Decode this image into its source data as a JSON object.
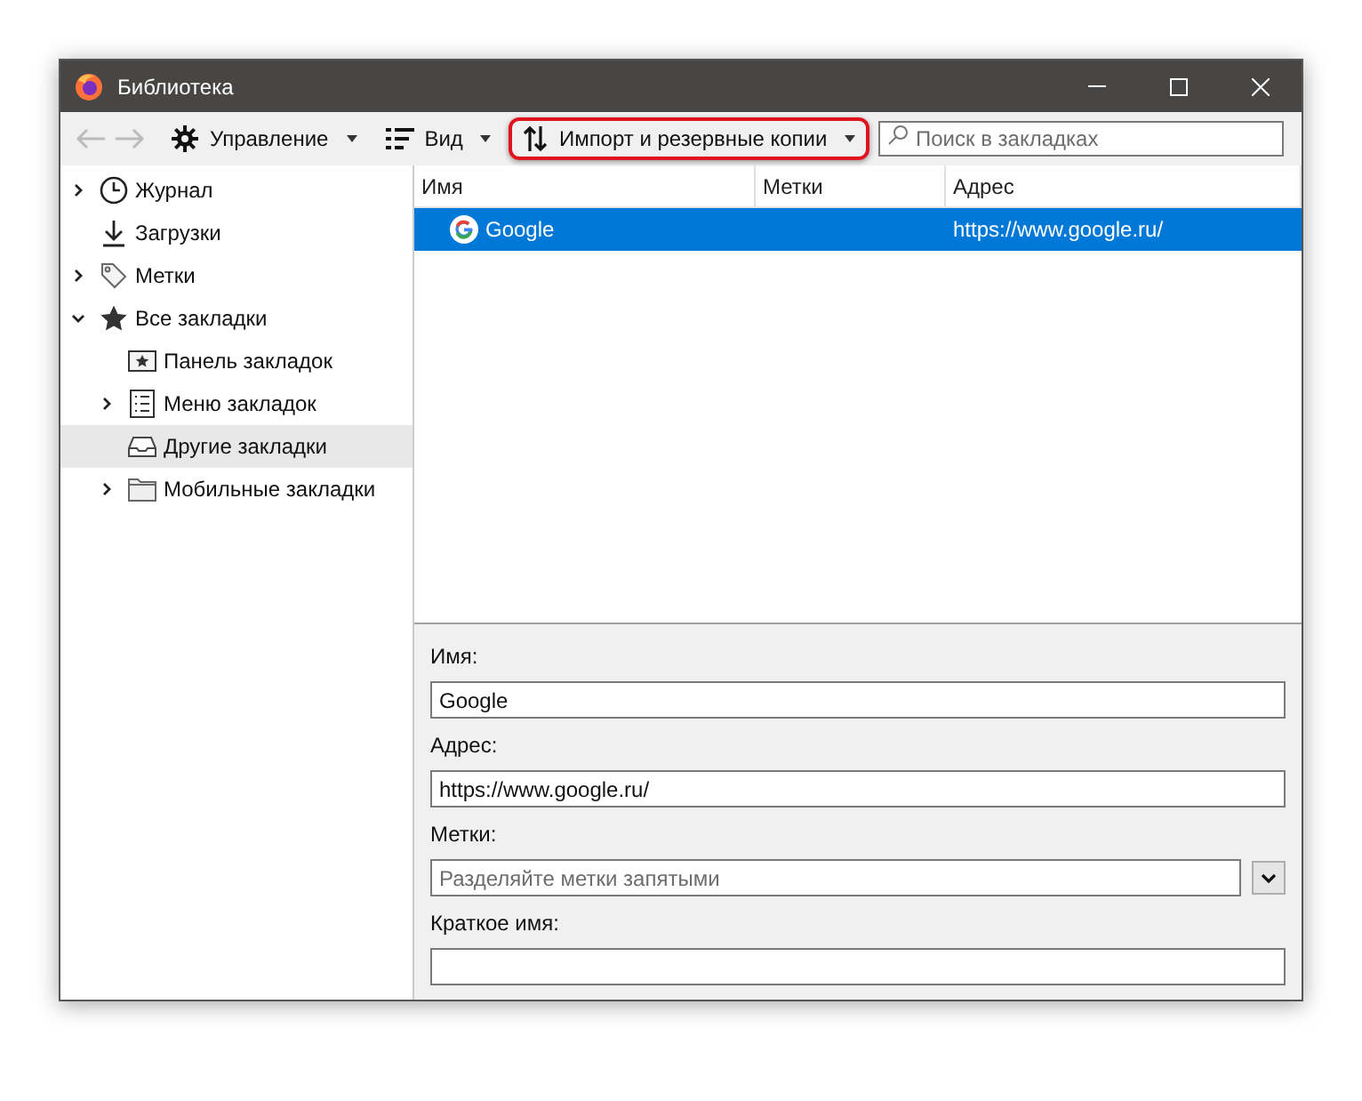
{
  "window": {
    "title": "Библиотека"
  },
  "toolbar": {
    "menus": [
      {
        "kind": "gear",
        "label": "Управление",
        "highlighted": false
      },
      {
        "kind": "view",
        "label": "Вид",
        "highlighted": false
      },
      {
        "kind": "import",
        "label": "Импорт и резервные копии",
        "highlighted": true
      }
    ],
    "search": {
      "placeholder": "Поиск в закладках"
    }
  },
  "sidebar": {
    "items": [
      {
        "kind": "clock",
        "label": "Журнал",
        "expanded": false,
        "selected": false
      },
      {
        "kind": "download",
        "label": "Загрузки",
        "selected": false
      },
      {
        "kind": "tag",
        "label": "Метки",
        "expanded": false,
        "selected": false
      },
      {
        "kind": "star",
        "label": "Все закладки",
        "expanded": true,
        "selected": false,
        "children": [
          {
            "kind": "toolbar",
            "label": "Панель закладок",
            "selected": false
          },
          {
            "kind": "menu",
            "label": "Меню закладок",
            "expanded": false,
            "selected": false
          },
          {
            "kind": "tray",
            "label": "Другие закладки",
            "selected": true
          },
          {
            "kind": "folder",
            "label": "Мобильные закладки",
            "expanded": false,
            "selected": false
          }
        ]
      }
    ]
  },
  "table": {
    "columns": [
      "Имя",
      "Метки",
      "Адрес"
    ],
    "rows": [
      {
        "name": "Google",
        "tags": "",
        "address": "https://www.google.ru/",
        "selected": true
      }
    ]
  },
  "details": {
    "fields": [
      {
        "label": "Имя:",
        "value": "Google"
      },
      {
        "label": "Адрес:",
        "value": "https://www.google.ru/"
      },
      {
        "label": "Метки:",
        "placeholder": "Разделяйте метки запятыми",
        "dropdown": true
      },
      {
        "label": "Краткое имя:"
      }
    ]
  }
}
